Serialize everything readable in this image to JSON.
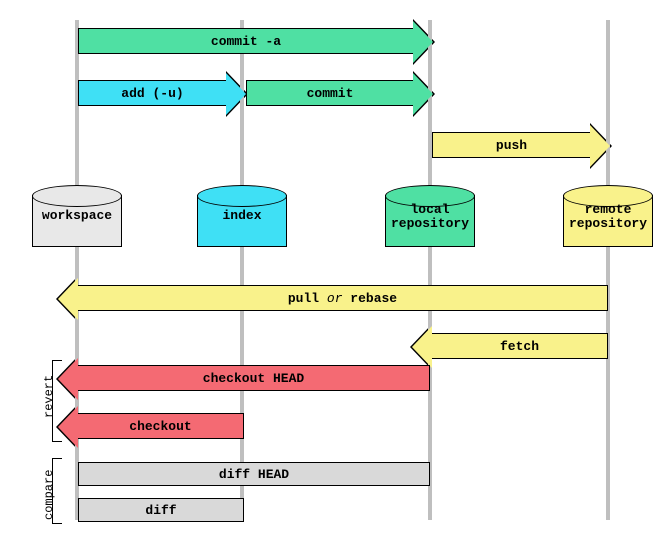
{
  "stages": {
    "workspace": "workspace",
    "index": "index",
    "local": "local repository",
    "remote": "remote repository"
  },
  "arrows": {
    "commit_a": "commit -a",
    "add_u": "add (-u)",
    "commit": "commit",
    "push": "push",
    "pull_or_rebase_a": "pull ",
    "pull_or_rebase_b": "or",
    "pull_or_rebase_c": " rebase",
    "fetch": "fetch",
    "checkout_head": "checkout HEAD",
    "checkout": "checkout",
    "diff_head": "diff HEAD",
    "diff": "diff"
  },
  "sections": {
    "revert": "revert",
    "compare": "compare"
  },
  "colors": {
    "green": "#4fe0a3",
    "cyan": "#3fe0f5",
    "yellow": "#f9f28b",
    "red": "#f46a73",
    "grey": "#d9d9d9"
  }
}
